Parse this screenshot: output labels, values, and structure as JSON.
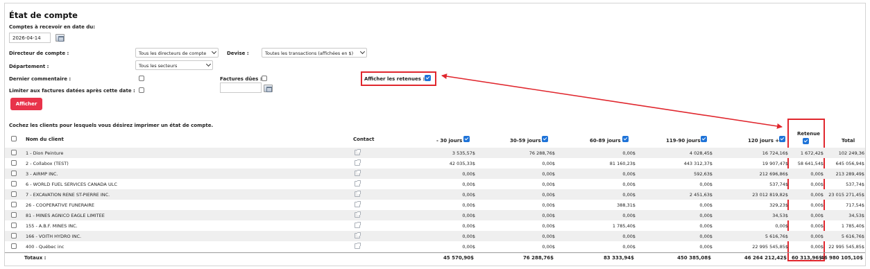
{
  "page_title": "État de compte",
  "receivable_label": "Comptes à recevoir en date du:",
  "date_value": "2026-04-14",
  "account_director_label": "Directeur de compte :",
  "account_director_value": "Tous les directeurs de compte",
  "currency_label": "Devise :",
  "currency_value": "Toutes les transactions (affichées en $)",
  "department_label": "Département :",
  "department_value": "Tous les secteurs",
  "last_comment_label": "Dernier commentaire :",
  "due_invoices_label": "Factures dûes :",
  "show_retentions_label": "Afficher les retenues :",
  "limit_label": "Limiter aux factures datées après cette date :",
  "show_button": "Afficher",
  "instruction": "Cochez les clients pour lesquels vous désirez imprimer un état de compte.",
  "columns": {
    "client": "Nom du client",
    "contact": "Contact",
    "d30": "- 30 jours",
    "d30_59": "30-59 jours",
    "d60_89": "60-89 jours",
    "d119_90": "119-90 jours",
    "d120": "120 jours +",
    "retenue": "Retenue",
    "total": "Total"
  },
  "rows": [
    {
      "client": "1 - Dion Peinture",
      "d30": "3 535,57$",
      "d30_59": "76 288,76$",
      "d60_89": "0,00$",
      "d119_90": "4 028,45$",
      "d120": "16 724,16$",
      "retenue": "1 672,42$",
      "total": "102 249,36"
    },
    {
      "client": "2 - Collabox (TEST)",
      "d30": "42 035,33$",
      "d30_59": "0,00$",
      "d60_89": "81 160,23$",
      "d119_90": "443 312,37$",
      "d120": "19 907,47$",
      "retenue": "58 641,54$",
      "total": "645 056,94$"
    },
    {
      "client": "3 - AIRMP INC.",
      "d30": "0,00$",
      "d30_59": "0,00$",
      "d60_89": "0,00$",
      "d119_90": "592,63$",
      "d120": "212 696,86$",
      "retenue": "0,00$",
      "total": "213 289,49$"
    },
    {
      "client": "6 - WORLD FUEL SERVICES CANADA ULC",
      "d30": "0,00$",
      "d30_59": "0,00$",
      "d60_89": "0,00$",
      "d119_90": "0,00$",
      "d120": "537,74$",
      "retenue": "0,00$",
      "total": "537,74$"
    },
    {
      "client": "7 - EXCAVATION RENE ST-PIERRE INC.",
      "d30": "0,00$",
      "d30_59": "0,00$",
      "d60_89": "0,00$",
      "d119_90": "2 451,63$",
      "d120": "23 012 819,82$",
      "retenue": "0,00$",
      "total": "23 015 271,45$"
    },
    {
      "client": "26 - COOPERATIVE FUNERAIRE",
      "d30": "0,00$",
      "d30_59": "0,00$",
      "d60_89": "388,31$",
      "d119_90": "0,00$",
      "d120": "329,23$",
      "retenue": "0,00$",
      "total": "717,54$"
    },
    {
      "client": "81 - MINES AGNICO EAGLE LIMITEE",
      "d30": "0,00$",
      "d30_59": "0,00$",
      "d60_89": "0,00$",
      "d119_90": "0,00$",
      "d120": "34,53$",
      "retenue": "0,00$",
      "total": "34,53$"
    },
    {
      "client": "155 - A.B.F. MINES INC.",
      "d30": "0,00$",
      "d30_59": "0,00$",
      "d60_89": "1 785,40$",
      "d119_90": "0,00$",
      "d120": "0,00$",
      "retenue": "0,00$",
      "total": "1 785,40$"
    },
    {
      "client": "166 - VOITH HYDRO INC.",
      "d30": "0,00$",
      "d30_59": "0,00$",
      "d60_89": "0,00$",
      "d119_90": "0,00$",
      "d120": "5 616,76$",
      "retenue": "0,00$",
      "total": "5 616,76$"
    },
    {
      "client": "400 - Québec inc",
      "d30": "0,00$",
      "d30_59": "0,00$",
      "d60_89": "0,00$",
      "d119_90": "0,00$",
      "d120": "22 995 545,85$",
      "retenue": "0,00$",
      "total": "22 995 545,85$"
    }
  ],
  "totals": {
    "label": "Totaux :",
    "d30": "45 570,90$",
    "d30_59": "76 288,76$",
    "d60_89": "83 333,94$",
    "d119_90": "450 385,08$",
    "d120": "46 264 212,42$",
    "retenue": "60 313,96$",
    "total": "46 980 105,10$"
  },
  "colors": {
    "accent": "#e8334a",
    "annotation": "#e0262d",
    "checkbox": "#1e73d8"
  }
}
